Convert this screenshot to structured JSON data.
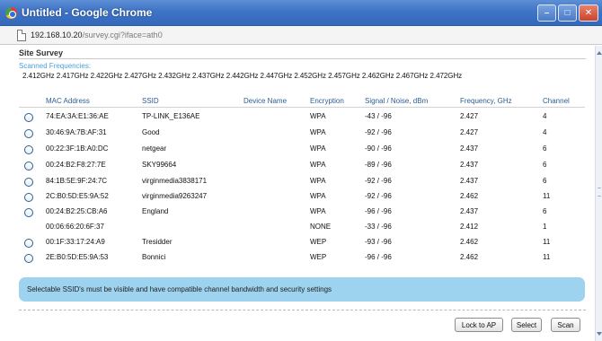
{
  "window": {
    "title": "Untitled - Google Chrome",
    "url_host": "192.168.10.20",
    "url_path": "/survey.cgi?iface=ath0",
    "minimize": "–",
    "maximize": "□",
    "close": "✕"
  },
  "page": {
    "section_title": "Site Survey",
    "scanned_label": "Scanned Frequencies:",
    "scanned_frequencies": "2.412GHz 2.417GHz 2.422GHz 2.427GHz 2.432GHz 2.437GHz 2.442GHz 2.447GHz 2.452GHz 2.457GHz 2.462GHz 2.467GHz 2.472GHz"
  },
  "table": {
    "headers": [
      "MAC Address",
      "SSID",
      "Device Name",
      "Encryption",
      "Signal / Noise, dBm",
      "Frequency, GHz",
      "Channel"
    ],
    "rows": [
      {
        "selectable": true,
        "mac": "74:EA:3A:E1:36:AE",
        "ssid": "TP-LINK_E136AE",
        "device": "",
        "encryption": "WPA",
        "signal": "-43 / -96",
        "frequency": "2.427",
        "channel": "4"
      },
      {
        "selectable": true,
        "mac": "30:46:9A:7B:AF:31",
        "ssid": "Good",
        "device": "",
        "encryption": "WPA",
        "signal": "-92 / -96",
        "frequency": "2.427",
        "channel": "4"
      },
      {
        "selectable": true,
        "mac": "00:22:3F:1B:A0:DC",
        "ssid": "netgear",
        "device": "",
        "encryption": "WPA",
        "signal": "-90 / -96",
        "frequency": "2.437",
        "channel": "6"
      },
      {
        "selectable": true,
        "mac": "00:24:B2:F8:27:7E",
        "ssid": "SKY99664",
        "device": "",
        "encryption": "WPA",
        "signal": "-89 / -96",
        "frequency": "2.437",
        "channel": "6"
      },
      {
        "selectable": true,
        "mac": "84:1B:5E:9F:24:7C",
        "ssid": "virginmedia3838171",
        "device": "",
        "encryption": "WPA",
        "signal": "-92 / -96",
        "frequency": "2.437",
        "channel": "6"
      },
      {
        "selectable": true,
        "mac": "2C:B0:5D:E5:9A:52",
        "ssid": "virginmedia9263247",
        "device": "",
        "encryption": "WPA",
        "signal": "-92 / -96",
        "frequency": "2.462",
        "channel": "11"
      },
      {
        "selectable": true,
        "mac": "00:24:B2:25:CB:A6",
        "ssid": "England",
        "device": "",
        "encryption": "WPA",
        "signal": "-96 / -96",
        "frequency": "2.437",
        "channel": "6"
      },
      {
        "selectable": false,
        "mac": "00:06:66:20:6F:37",
        "ssid": "",
        "device": "",
        "encryption": "NONE",
        "signal": "-33 / -96",
        "frequency": "2.412",
        "channel": "1"
      },
      {
        "selectable": true,
        "mac": "00:1F:33:17:24:A9",
        "ssid": "Tresidder",
        "device": "",
        "encryption": "WEP",
        "signal": "-93 / -96",
        "frequency": "2.462",
        "channel": "11"
      },
      {
        "selectable": true,
        "mac": "2E:B0:5D:E5:9A:53",
        "ssid": "Bonnici",
        "device": "",
        "encryption": "WEP",
        "signal": "-96 / -96",
        "frequency": "2.462",
        "channel": "11"
      }
    ]
  },
  "notice": "Selectable SSID's must be visible and have compatible channel bandwidth and security settings",
  "buttons": {
    "lock": "Lock to AP",
    "select": "Select",
    "scan": "Scan"
  },
  "colors": {
    "titlebar": "#3f73c4",
    "header_text": "#2b5e93",
    "notice_bg": "#9ed3ef",
    "scanned_label": "#4aa0d9"
  }
}
